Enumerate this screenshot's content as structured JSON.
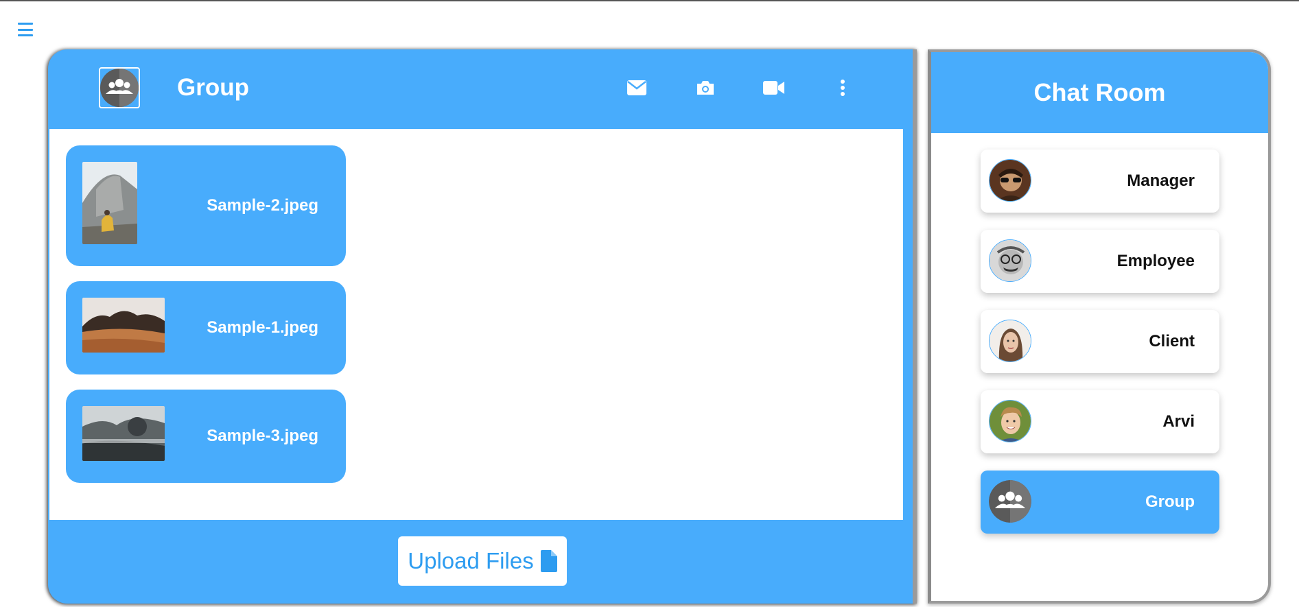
{
  "menu": {
    "icon": "hamburger-menu-icon"
  },
  "group_panel": {
    "title": "Group",
    "avatar_icon": "group-avatar-icon",
    "actions": [
      {
        "name": "mail-icon"
      },
      {
        "name": "camera-icon"
      },
      {
        "name": "video-camera-icon"
      },
      {
        "name": "more-vertical-icon"
      }
    ],
    "files": [
      {
        "name": "Sample-2.jpeg",
        "thumb": "rock-climber-thumbnail"
      },
      {
        "name": "Sample-1.jpeg",
        "thumb": "desert-landscape-thumbnail"
      },
      {
        "name": "Sample-3.jpeg",
        "thumb": "foggy-mountains-thumbnail"
      }
    ],
    "upload_label": "Upload Files",
    "upload_icon": "file-icon"
  },
  "chat_room": {
    "title": "Chat Room",
    "contacts": [
      {
        "name": "Manager",
        "avatar": "manager-avatar"
      },
      {
        "name": "Employee",
        "avatar": "employee-avatar"
      },
      {
        "name": "Client",
        "avatar": "client-avatar"
      },
      {
        "name": "Arvi",
        "avatar": "arvi-avatar"
      },
      {
        "name": "Group",
        "avatar": "group-avatar-icon",
        "active": true
      }
    ]
  },
  "colors": {
    "accent": "#48acfc",
    "accent_text": "#2d9cf0",
    "panel_border": "#9a9a9a"
  }
}
